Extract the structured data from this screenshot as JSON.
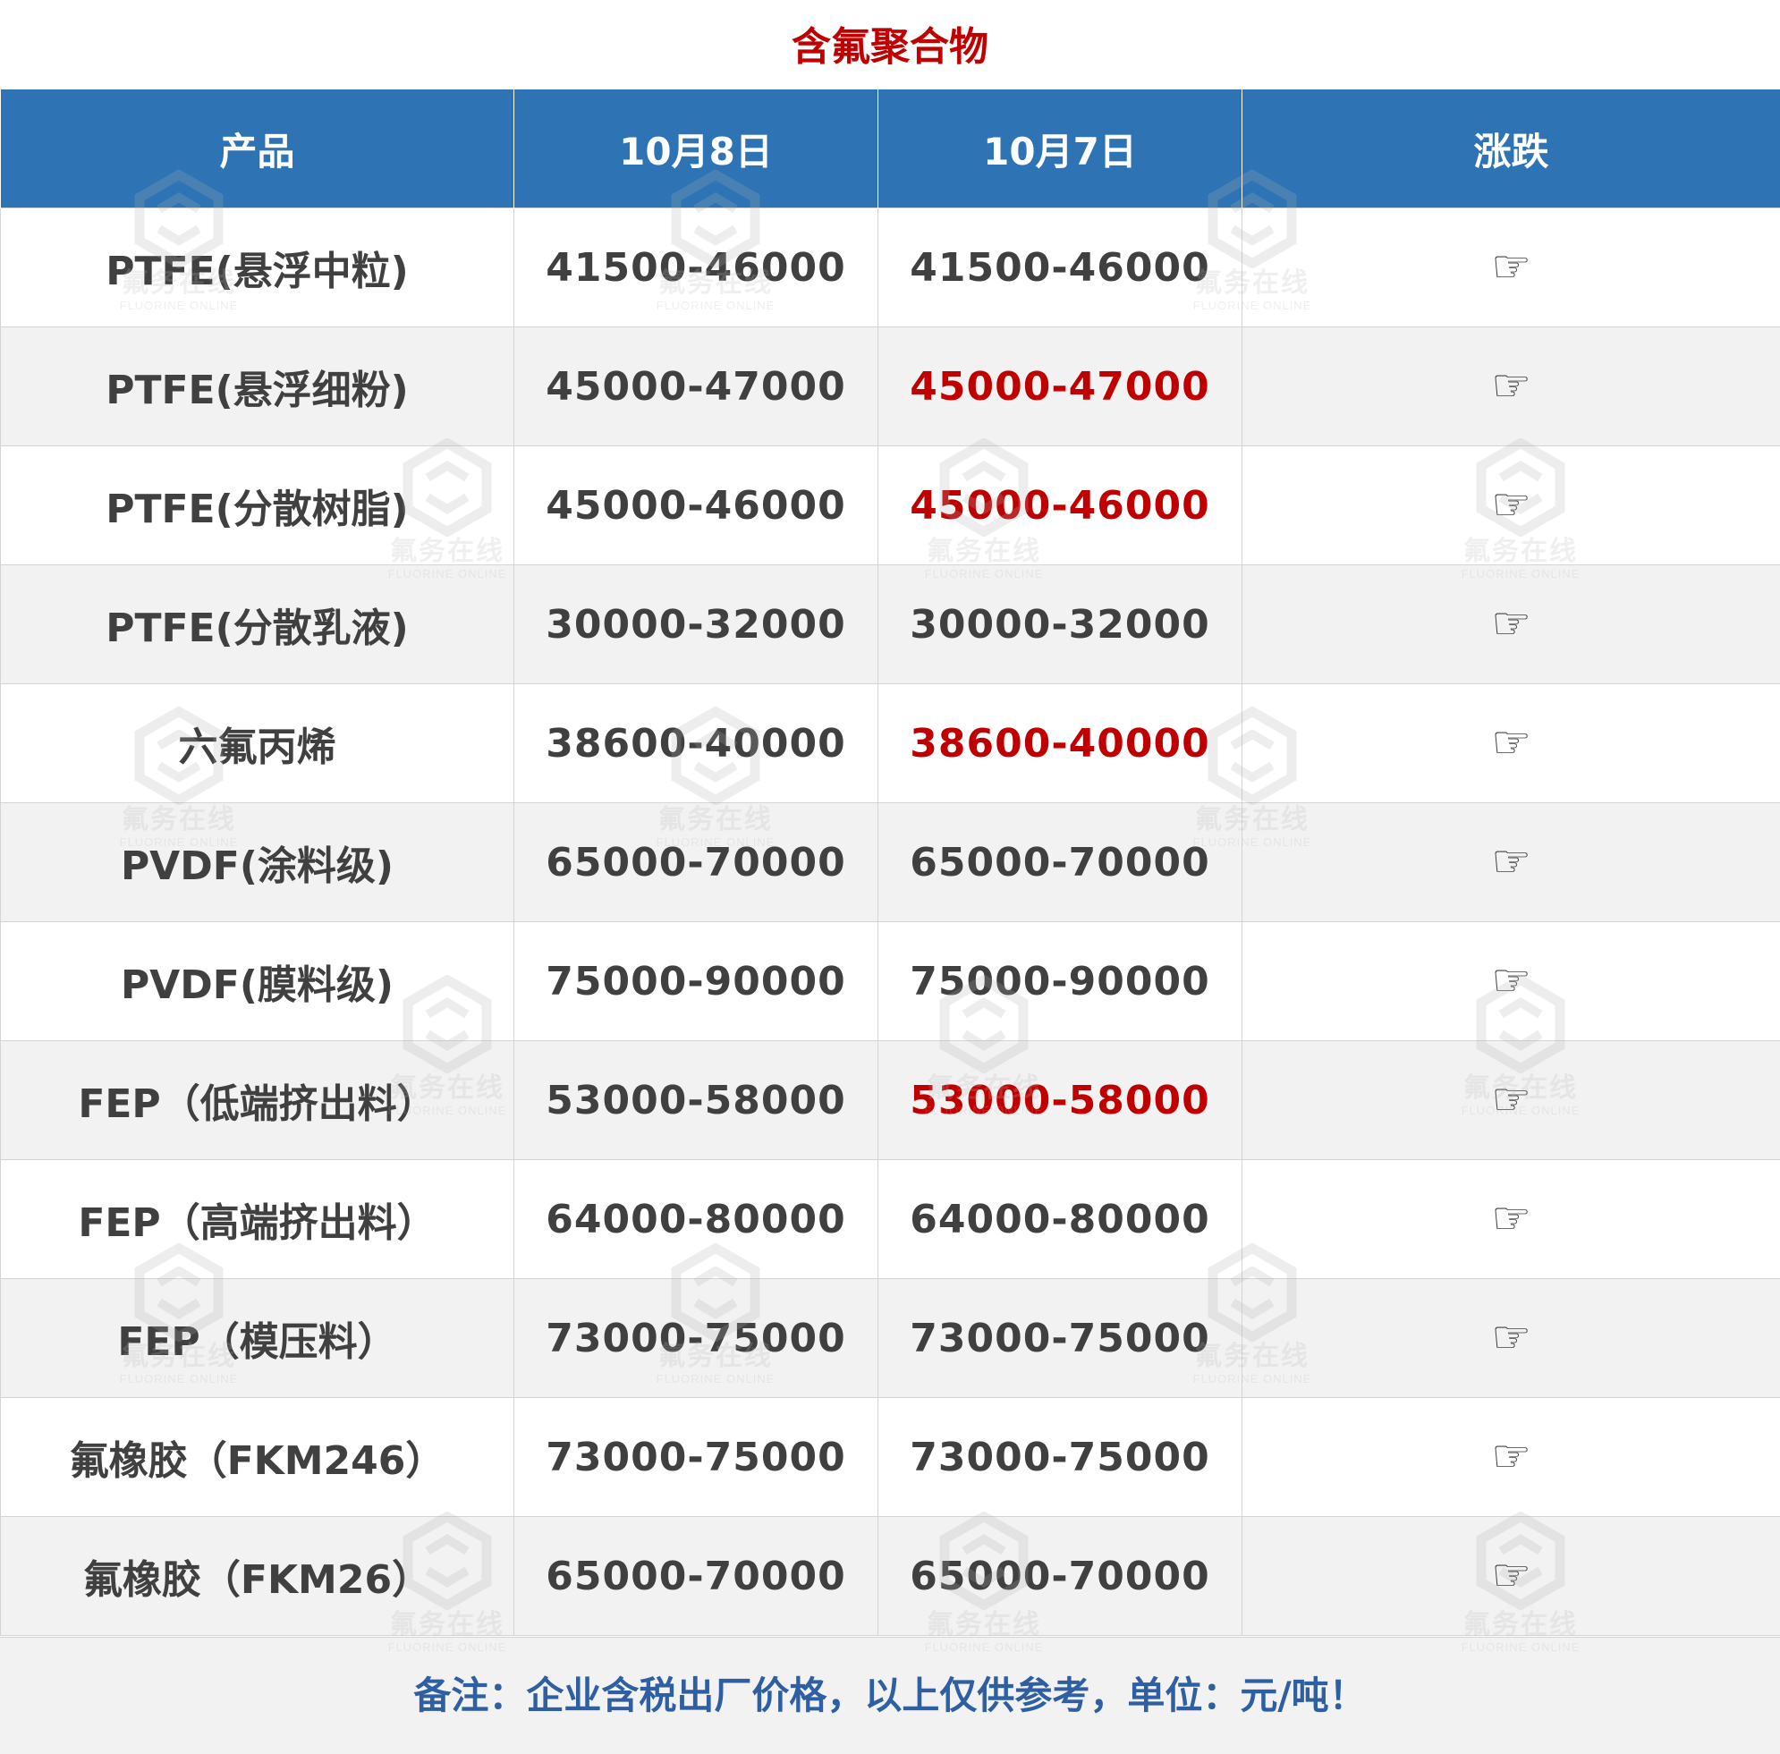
{
  "title": "含氟聚合物",
  "table": {
    "headers": [
      "产品",
      "10月8日",
      "10月7日",
      "涨跌"
    ],
    "rows": [
      {
        "product": "PTFE(悬浮中粒)",
        "oct8": "41500-46000",
        "oct7": "41500-46000",
        "oct7_highlight": false,
        "change_icon": "pointing-hand-icon"
      },
      {
        "product": "PTFE(悬浮细粉)",
        "oct8": "45000-47000",
        "oct7": "45000-47000",
        "oct7_highlight": true,
        "change_icon": "pointing-hand-icon"
      },
      {
        "product": "PTFE(分散树脂)",
        "oct8": "45000-46000",
        "oct7": "45000-46000",
        "oct7_highlight": true,
        "change_icon": "pointing-hand-icon"
      },
      {
        "product": "PTFE(分散乳液)",
        "oct8": "30000-32000",
        "oct7": "30000-32000",
        "oct7_highlight": false,
        "change_icon": "pointing-hand-icon"
      },
      {
        "product": "六氟丙烯",
        "oct8": "38600-40000",
        "oct7": "38600-40000",
        "oct7_highlight": true,
        "change_icon": "pointing-hand-icon"
      },
      {
        "product": "PVDF(涂料级)",
        "oct8": "65000-70000",
        "oct7": "65000-70000",
        "oct7_highlight": false,
        "change_icon": "pointing-hand-icon"
      },
      {
        "product": "PVDF(膜料级)",
        "oct8": "75000-90000",
        "oct7": "75000-90000",
        "oct7_highlight": false,
        "change_icon": "pointing-hand-icon"
      },
      {
        "product": "FEP（低端挤出料）",
        "oct8": "53000-58000",
        "oct7": "53000-58000",
        "oct7_highlight": true,
        "change_icon": "pointing-hand-icon"
      },
      {
        "product": "FEP（高端挤出料）",
        "oct8": "64000-80000",
        "oct7": "64000-80000",
        "oct7_highlight": false,
        "change_icon": "pointing-hand-icon"
      },
      {
        "product": "FEP（模压料）",
        "oct8": "73000-75000",
        "oct7": "73000-75000",
        "oct7_highlight": false,
        "change_icon": "pointing-hand-icon"
      },
      {
        "product": "氟橡胶（FKM246）",
        "oct8": "73000-75000",
        "oct7": "73000-75000",
        "oct7_highlight": false,
        "change_icon": "pointing-hand-icon"
      },
      {
        "product": "氟橡胶（FKM26）",
        "oct8": "65000-70000",
        "oct7": "65000-70000",
        "oct7_highlight": false,
        "change_icon": "pointing-hand-icon"
      }
    ]
  },
  "note": "备注：企业含税出厂价格，以上仅供参考，单位：元/吨！",
  "watermark": {
    "cn": "氟务在线",
    "en": "FLUORINE ONLINE"
  },
  "colors": {
    "header_bg": "#2e74b5",
    "title_red": "#c00000",
    "highlight_red": "#c00000",
    "note_blue": "#2e5fa3",
    "stripe_gray": "#f2f2f2"
  }
}
